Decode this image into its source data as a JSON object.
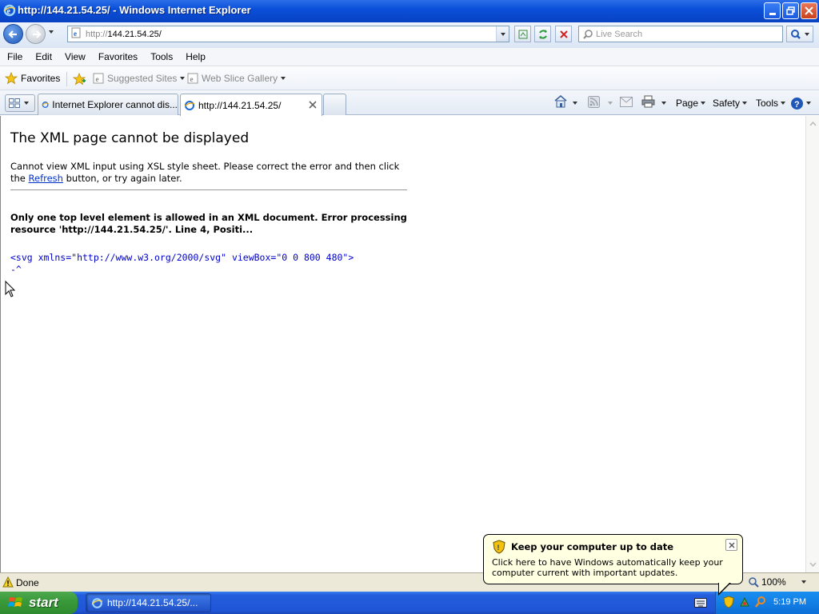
{
  "window": {
    "title": "http://144.21.54.25/ - Windows Internet Explorer"
  },
  "address_bar": {
    "url_prefix": "http://",
    "url_host": "144.21.54.25/"
  },
  "search": {
    "placeholder": "Live Search"
  },
  "menu": {
    "items": [
      "File",
      "Edit",
      "View",
      "Favorites",
      "Tools",
      "Help"
    ]
  },
  "favorites_bar": {
    "favorites_label": "Favorites",
    "suggested_sites": "Suggested Sites",
    "web_slice_gallery": "Web Slice Gallery"
  },
  "tabs": [
    {
      "label": "Internet Explorer cannot dis...",
      "active": false
    },
    {
      "label": "http://144.21.54.25/",
      "active": true
    }
  ],
  "command_bar": {
    "page": "Page",
    "safety": "Safety",
    "tools": "Tools"
  },
  "page": {
    "title": "The XML page cannot be displayed",
    "desc_before": "Cannot view XML input using XSL style sheet. Please correct the error and then click the ",
    "desc_link": "Refresh",
    "desc_after": " button, or try again later.",
    "detail": "Only one top level element is allowed in an XML document. Error processing resource 'http://144.21.54.25/'. Line 4, Positi...",
    "source_line": "<svg xmlns=\"http://www.w3.org/2000/svg\" viewBox=\"0 0 800 480\">",
    "source_marker": "-^"
  },
  "status_bar": {
    "text": "Done",
    "zoom": "100%"
  },
  "balloon": {
    "title": "Keep your computer up to date",
    "body": "Click here to have Windows automatically keep your computer current with important updates."
  },
  "taskbar": {
    "start_label": "start",
    "task_item": "http://144.21.54.25/...",
    "clock": "5:19 PM"
  },
  "colors": {
    "titlebar": "#0a4fd9",
    "taskbar": "#245edc",
    "start_green": "#3a9a3a",
    "link": "#0033cc",
    "source_text": "#0000cc",
    "balloon_bg": "#ffffe1"
  }
}
